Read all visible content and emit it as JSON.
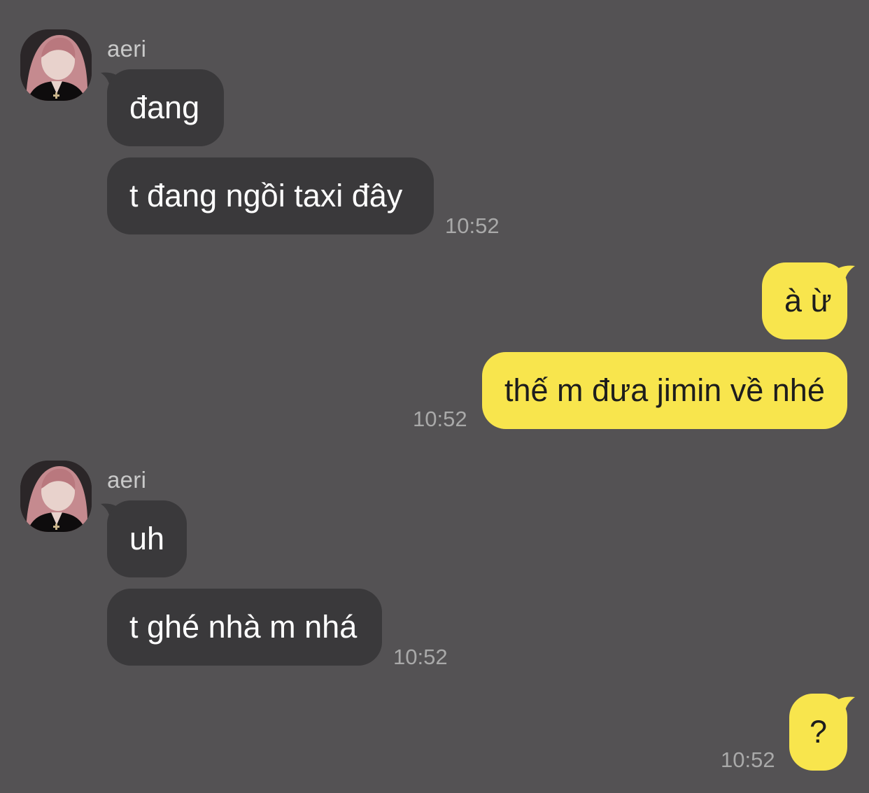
{
  "theme": {
    "background": "#545254",
    "incoming_bubble": "#3a393b",
    "outgoing_bubble": "#f8e54d",
    "incoming_text": "#ffffff",
    "outgoing_text": "#1d1d1d",
    "timestamp_color": "#a9a9a9",
    "sender_color": "#c9c9c9"
  },
  "groups": [
    {
      "direction": "incoming",
      "sender": "aeri",
      "avatar_icon": "profile-photo",
      "messages": [
        {
          "text": "đang"
        },
        {
          "text": "t đang ngồi taxi đây",
          "time": "10:52"
        }
      ]
    },
    {
      "direction": "outgoing",
      "messages": [
        {
          "text": "à ừ"
        },
        {
          "text": "thế m đưa jimin về nhé",
          "time": "10:52"
        }
      ]
    },
    {
      "direction": "incoming",
      "sender": "aeri",
      "avatar_icon": "profile-photo",
      "messages": [
        {
          "text": "uh"
        },
        {
          "text": "t ghé nhà m nhá",
          "time": "10:52"
        }
      ]
    },
    {
      "direction": "outgoing",
      "messages": [
        {
          "text": "?",
          "time": "10:52"
        }
      ]
    }
  ]
}
